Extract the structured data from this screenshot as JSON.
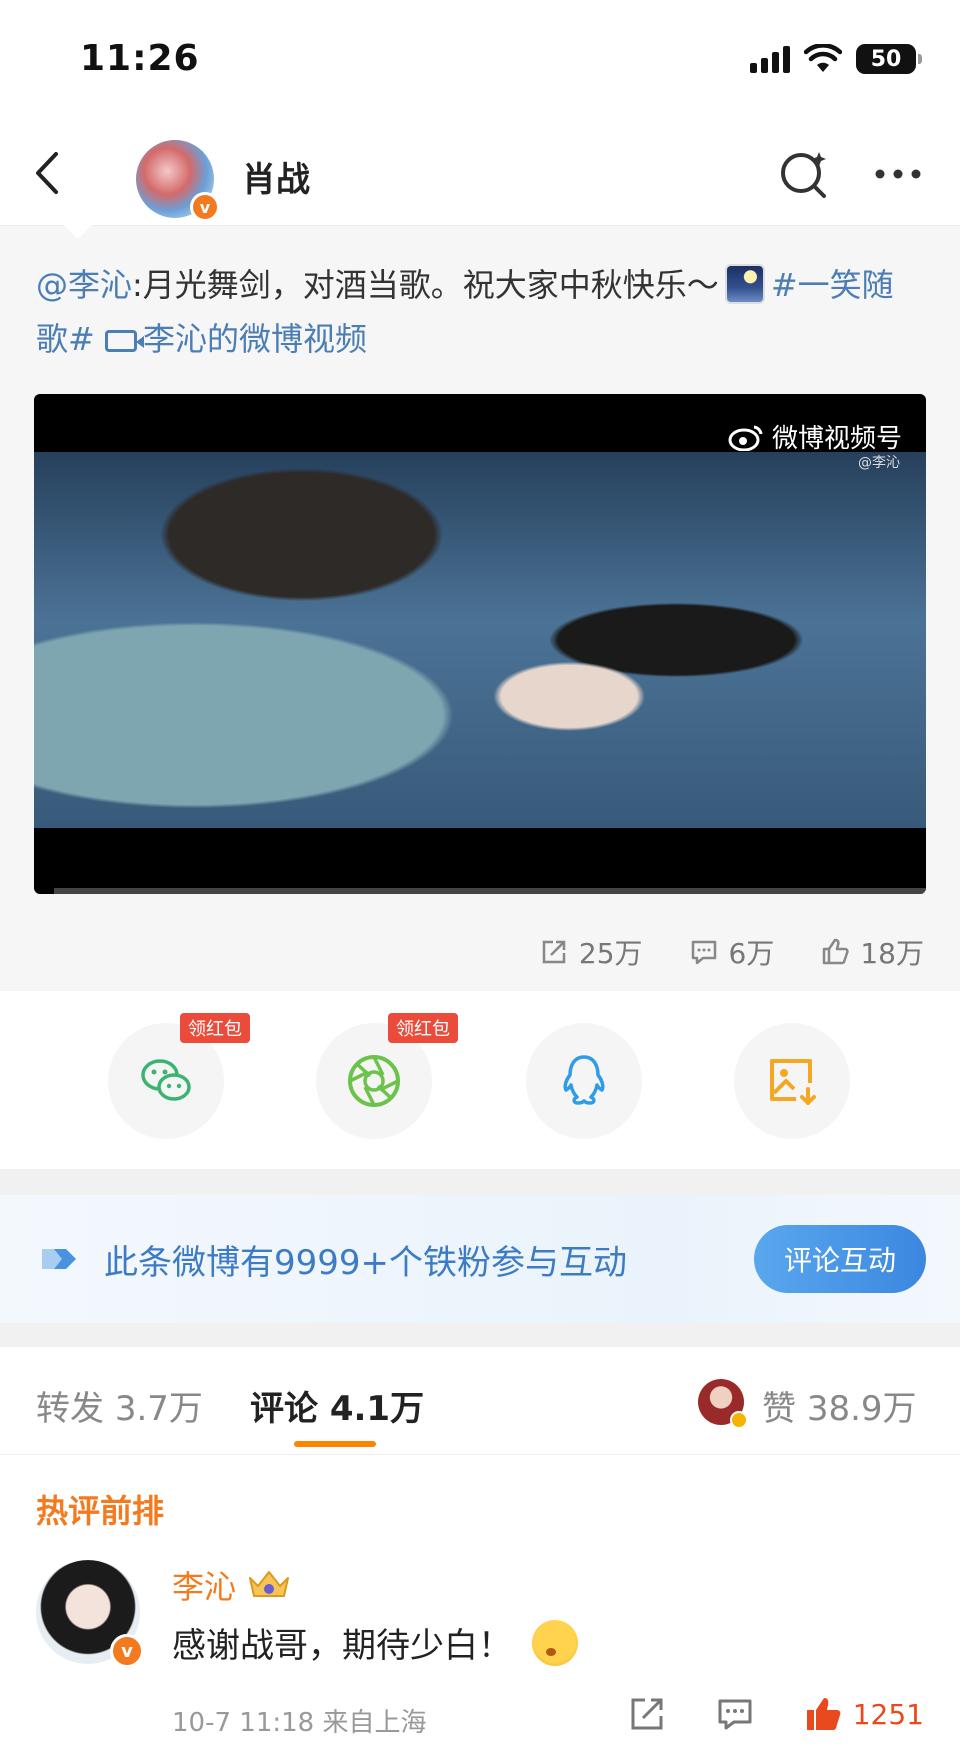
{
  "status_bar": {
    "time": "11:26",
    "battery": "50"
  },
  "header": {
    "title": "肖战"
  },
  "post": {
    "mention": "@李沁",
    "text": ":月光舞剑，对酒当歌。祝大家中秋快乐～",
    "hashtag": "#一笑随歌#",
    "video_link": "李沁的微博视频",
    "video_watermark": "微博视频号",
    "video_watermark_sub": "@李沁",
    "stats": {
      "reposts": "25万",
      "comments": "6万",
      "likes": "18万"
    }
  },
  "share": {
    "badge_1": "领红包",
    "badge_2": "领红包"
  },
  "banner": {
    "text": "此条微博有9999+个铁粉参与互动",
    "button": "评论互动"
  },
  "tabs": {
    "repost_label": "转发",
    "repost_count": "3.7万",
    "comment_label": "评论",
    "comment_count": "4.1万",
    "like_label": "赞",
    "like_count": "38.9万"
  },
  "comments": {
    "section_title": "热评前排",
    "items": [
      {
        "author": "李沁",
        "text": "感谢战哥，期待少白！",
        "time": "10-7 11:18",
        "location": "来自上海",
        "likes": "1251"
      }
    ]
  },
  "colors": {
    "accent": "#f47a1f",
    "link": "#4a7eb5",
    "like": "#e84a1e"
  }
}
